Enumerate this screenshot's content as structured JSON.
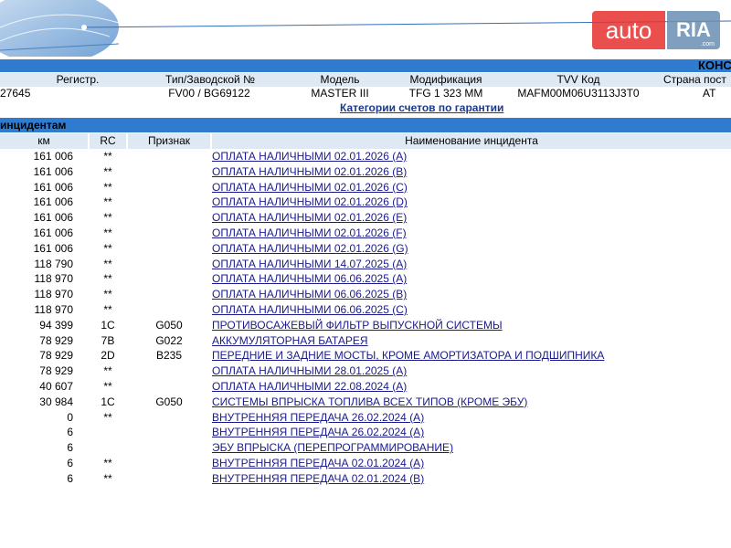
{
  "watermark": {
    "auto": "auto",
    "ria": "RIA",
    "com": ".com"
  },
  "header": {
    "right_label": "КОНС"
  },
  "vehicle": {
    "columns": [
      "Регистр.",
      "Тип/Заводской №",
      "Модель",
      "Модификация",
      "TVV Код",
      "Страна пост"
    ],
    "values": [
      "27645",
      "",
      "FV00 / BG69122",
      "MASTER III",
      "TFG 1 323 MM",
      "MAFM00M06U3113J3T0",
      "AT"
    ]
  },
  "warranty_link": "Категории счетов по гарантии",
  "incidents": {
    "title": "инцидентам",
    "columns": {
      "km": "км",
      "rc": "RC",
      "sign": "Признак",
      "name": "Наименование инцидента"
    },
    "rows": [
      {
        "km": "161 006",
        "rc": "**",
        "sign": "",
        "name": "ОПЛАТА НАЛИЧНЫМИ 02.01.2026 (A)"
      },
      {
        "km": "161 006",
        "rc": "**",
        "sign": "",
        "name": "ОПЛАТА НАЛИЧНЫМИ 02.01.2026 (B)"
      },
      {
        "km": "161 006",
        "rc": "**",
        "sign": "",
        "name": "ОПЛАТА НАЛИЧНЫМИ 02.01.2026 (C)"
      },
      {
        "km": "161 006",
        "rc": "**",
        "sign": "",
        "name": "ОПЛАТА НАЛИЧНЫМИ 02.01.2026 (D)"
      },
      {
        "km": "161 006",
        "rc": "**",
        "sign": "",
        "name": "ОПЛАТА НАЛИЧНЫМИ 02.01.2026 (E)"
      },
      {
        "km": "161 006",
        "rc": "**",
        "sign": "",
        "name": "ОПЛАТА НАЛИЧНЫМИ 02.01.2026 (F)"
      },
      {
        "km": "161 006",
        "rc": "**",
        "sign": "",
        "name": "ОПЛАТА НАЛИЧНЫМИ 02.01.2026 (G)"
      },
      {
        "km": "118 790",
        "rc": "**",
        "sign": "",
        "name": "ОПЛАТА НАЛИЧНЫМИ 14.07.2025 (A)"
      },
      {
        "km": "118 970",
        "rc": "**",
        "sign": "",
        "name": "ОПЛАТА НАЛИЧНЫМИ 06.06.2025 (A)"
      },
      {
        "km": "118 970",
        "rc": "**",
        "sign": "",
        "name": "ОПЛАТА НАЛИЧНЫМИ 06.06.2025 (B)"
      },
      {
        "km": "118 970",
        "rc": "**",
        "sign": "",
        "name": "ОПЛАТА НАЛИЧНЫМИ 06.06.2025 (C)"
      },
      {
        "km": "94 399",
        "rc": "1C",
        "sign": "G050",
        "name": "ПРОТИВОСАЖЕВЫЙ ФИЛЬТР ВЫПУСКНОЙ СИСТЕМЫ"
      },
      {
        "km": "78 929",
        "rc": "7B",
        "sign": "G022",
        "name": "АККУМУЛЯТОРНАЯ БАТАРЕЯ"
      },
      {
        "km": "78 929",
        "rc": "2D",
        "sign": "B235",
        "name": "ПЕРЕДНИЕ И ЗАДНИЕ МОСТЫ, КРОМЕ АМОРТИЗАТОРА И ПОДШИПНИКА"
      },
      {
        "km": "78 929",
        "rc": "**",
        "sign": "",
        "name": "ОПЛАТА НАЛИЧНЫМИ 28.01.2025 (A)"
      },
      {
        "km": "40 607",
        "rc": "**",
        "sign": "",
        "name": "ОПЛАТА НАЛИЧНЫМИ 22.08.2024 (A)"
      },
      {
        "km": "30 984",
        "rc": "1C",
        "sign": "G050",
        "name": "СИСТЕМЫ ВПРЫСКА ТОПЛИВА ВСЕХ ТИПОВ (КРОМЕ ЭБУ)"
      },
      {
        "km": "0",
        "rc": "**",
        "sign": "",
        "name": "ВНУТРЕННЯЯ ПЕРЕДАЧА 26.02.2024 (A)"
      },
      {
        "km": "6",
        "rc": "",
        "sign": "",
        "name": "ВНУТРЕННЯЯ ПЕРЕДАЧА 26.02.2024 (A)"
      },
      {
        "km": "6",
        "rc": "",
        "sign": "",
        "name": "ЭБУ ВПРЫСКА (ПЕРЕПРОГРАММИРОВАНИЕ)"
      },
      {
        "km": "6",
        "rc": "**",
        "sign": "",
        "name": "ВНУТРЕННЯЯ ПЕРЕДАЧА 02.01.2024 (A)"
      },
      {
        "km": "6",
        "rc": "**",
        "sign": "",
        "name": "ВНУТРЕННЯЯ ПЕРЕДАЧА 02.01.2024 (B)"
      }
    ]
  }
}
